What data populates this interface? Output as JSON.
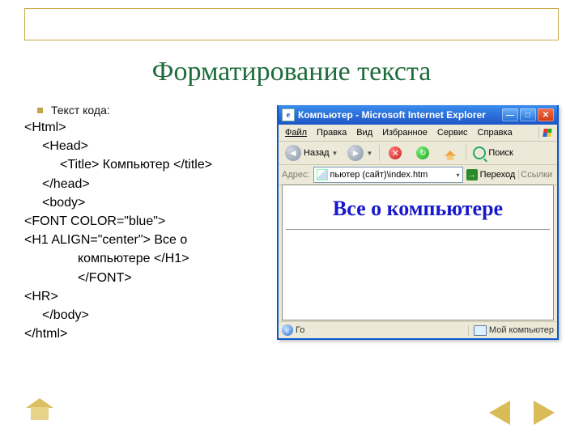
{
  "title": "Форматирование текста",
  "bullet_label": "Текст кода:",
  "code": {
    "l1_html_open": "<Html>",
    "l2_head_open": "<Head>",
    "l3_title": "<Title> Компьютер </title>",
    "l2_head_close": "</head>",
    "l2_body_open": "<body>",
    "l1_font_open": "<FONT COLOR=\"blue\">",
    "l1_h1_line1": "<H1 ALIGN=\"center\"> Все о",
    "l1_h1_line2": "компьютере </H1>",
    "l1_font_close": "</FONT>",
    "l1_hr": "<HR>",
    "l2_body_close": "</body>",
    "l1_html_close": "</html>"
  },
  "browser": {
    "window_title": "Компьютер - Microsoft Internet Explorer",
    "menu": {
      "file": "Файл",
      "edit": "Правка",
      "view": "Вид",
      "favorites": "Избранное",
      "tools": "Сервис",
      "help": "Справка"
    },
    "toolbar": {
      "back": "Назад",
      "search": "Поиск"
    },
    "addressbar": {
      "label": "Адрес:",
      "value": "пьютер (сайт)\\index.htm",
      "go": "Переход",
      "links": "Ссылки"
    },
    "page": {
      "heading": "Все о компьютере"
    },
    "status": {
      "left": "Го",
      "right": "Мой компьютер"
    }
  }
}
